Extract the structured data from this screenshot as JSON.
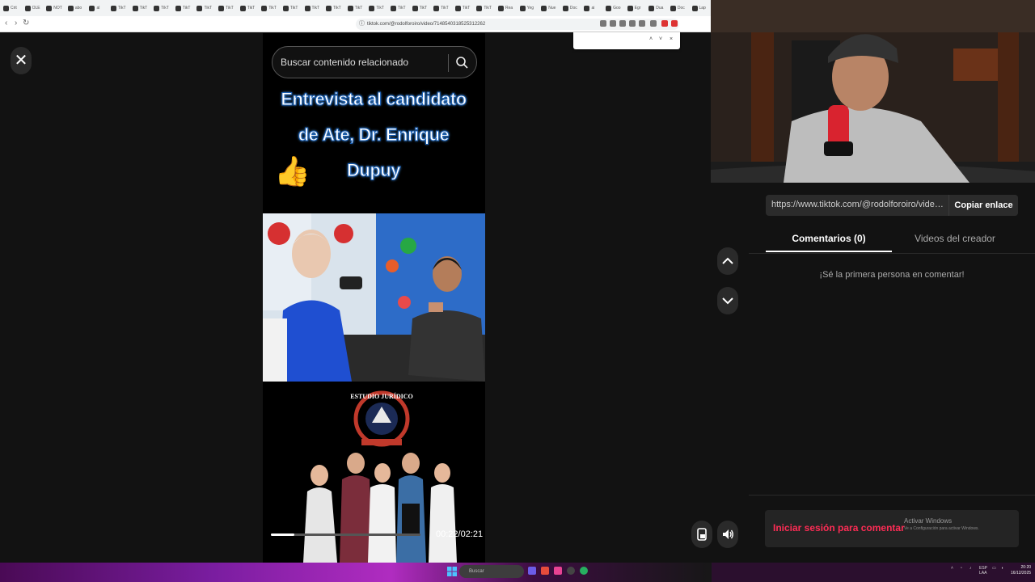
{
  "browser": {
    "tabs": [
      "Crit",
      "OLE",
      "NOT",
      "abo",
      "al",
      "TikT",
      "TikT",
      "TikT",
      "TikT",
      "TikT",
      "TikT",
      "TikT",
      "TikT",
      "TikT",
      "TikT",
      "TikT",
      "TikT",
      "TikT",
      "TikT",
      "TikT",
      "TikT",
      "TikT",
      "TikT",
      "Rea",
      "Yeg",
      "Nue",
      "Doc",
      "ai",
      "Goo",
      "Egr",
      "Dua",
      "Doc",
      "Lap"
    ],
    "url": "tiktok.com/@rodolforoiro/video/7148540318525312262",
    "back_icon": "back-icon",
    "reload_icon": "reload-icon"
  },
  "viewer": {
    "close_icon": "close-icon",
    "search": {
      "placeholder": "Buscar contenido relacionado",
      "icon": "search-icon"
    },
    "headline": [
      "Entrevista al candidato",
      "de Ate, Dr. Enrique",
      "Dupuy"
    ],
    "thumb_emoji": "👍",
    "promo_logo_text": "ESTUDIO JURÍDICO",
    "progress": 0.155,
    "time": "00:22/02:21",
    "up_icon": "chevron-up-icon",
    "down_icon": "chevron-down-icon",
    "device_icon": "device-icon",
    "volume_icon": "volume-icon"
  },
  "panel": {
    "share_url": "https://www.tiktok.com/@rodolforoiro/video/7148...",
    "copy_label": "Copiar enlace",
    "tabs": {
      "comments": "Comentarios (0)",
      "creator_videos": "Videos del creador"
    },
    "empty_message": "¡Sé la primera persona en comentar!",
    "login_label": "Iniciar sesión para comentar",
    "activate_title": "Activar Windows",
    "activate_sub": "Ve a Configuración para activar Windows."
  },
  "taskbar": {
    "search_label": "Buscar",
    "lang": "ESP",
    "lang_sub": "LAA",
    "time": "20:20",
    "date": "16/12/2025"
  },
  "colors": {
    "accent": "#fe2c55",
    "background": "#121212"
  }
}
